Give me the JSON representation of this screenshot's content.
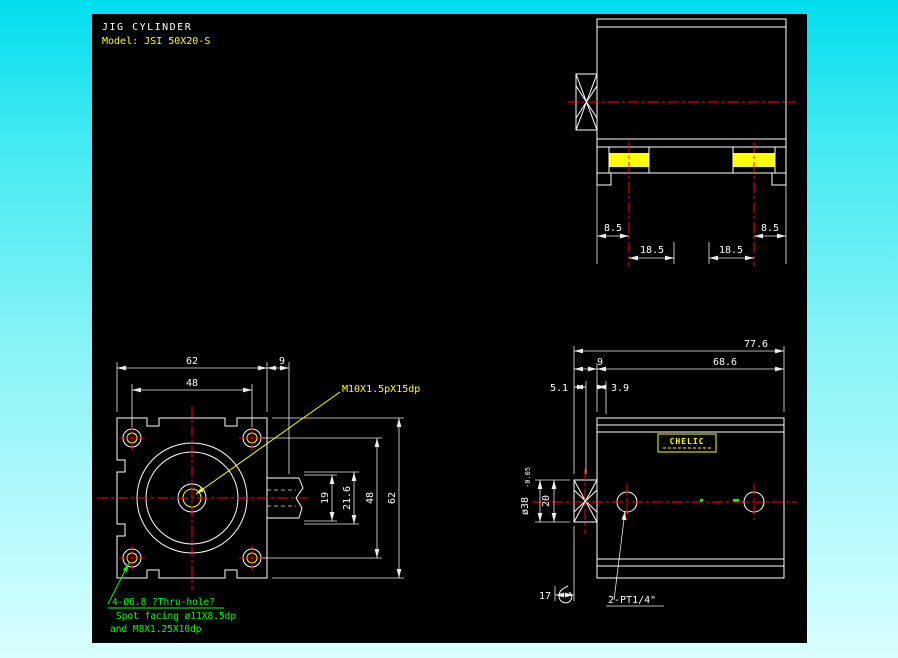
{
  "window": {
    "canvas_background": "#000000",
    "background_top": "#00ddee",
    "background_bottom": "#d9feff"
  },
  "colors": {
    "outline": "#ffffff",
    "centerline": "#ff0000",
    "dimension_text": "#ffffff",
    "note_green": "#00ff00",
    "note_yellow": "#ffff00",
    "highlight": "#ffff00"
  },
  "title_block": {
    "product": "JIG CYLINDER",
    "model": "Model: JSI 50X20-S"
  },
  "top_view": {
    "dim_edge_left": "8.5",
    "dim_pitch_left": "18.5",
    "dim_pitch_right": "18.5",
    "dim_edge_right": "8.5"
  },
  "front_view": {
    "dim_width_62": "62",
    "dim_tongue_9": "9",
    "dim_pitch_48": "48",
    "dim_h19": "19",
    "dim_h216": "21.6",
    "dim_vpitch_48": "48",
    "dim_height_62": "62",
    "thread_note": "M10X1.5pX15dp",
    "hole_note_line1": "4-Ø6.8   ?Thru-hole?",
    "hole_note_line2": "Spot facing ø11X8.5dp",
    "hole_note_line3": "and M8X1.25X10dp"
  },
  "side_view": {
    "dim_total_776": "77.6",
    "dim_rod_9": "9",
    "dim_body_686": "68.6",
    "dim_51": "5.1",
    "dim_39": "3.9",
    "dim_rod_dia": "ø38",
    "dim_rod_dia_tol": "-0.05",
    "dim_20": "20",
    "dim_17": "17",
    "port_note": "2-PT1/4\"",
    "logo": "CHELIC"
  }
}
